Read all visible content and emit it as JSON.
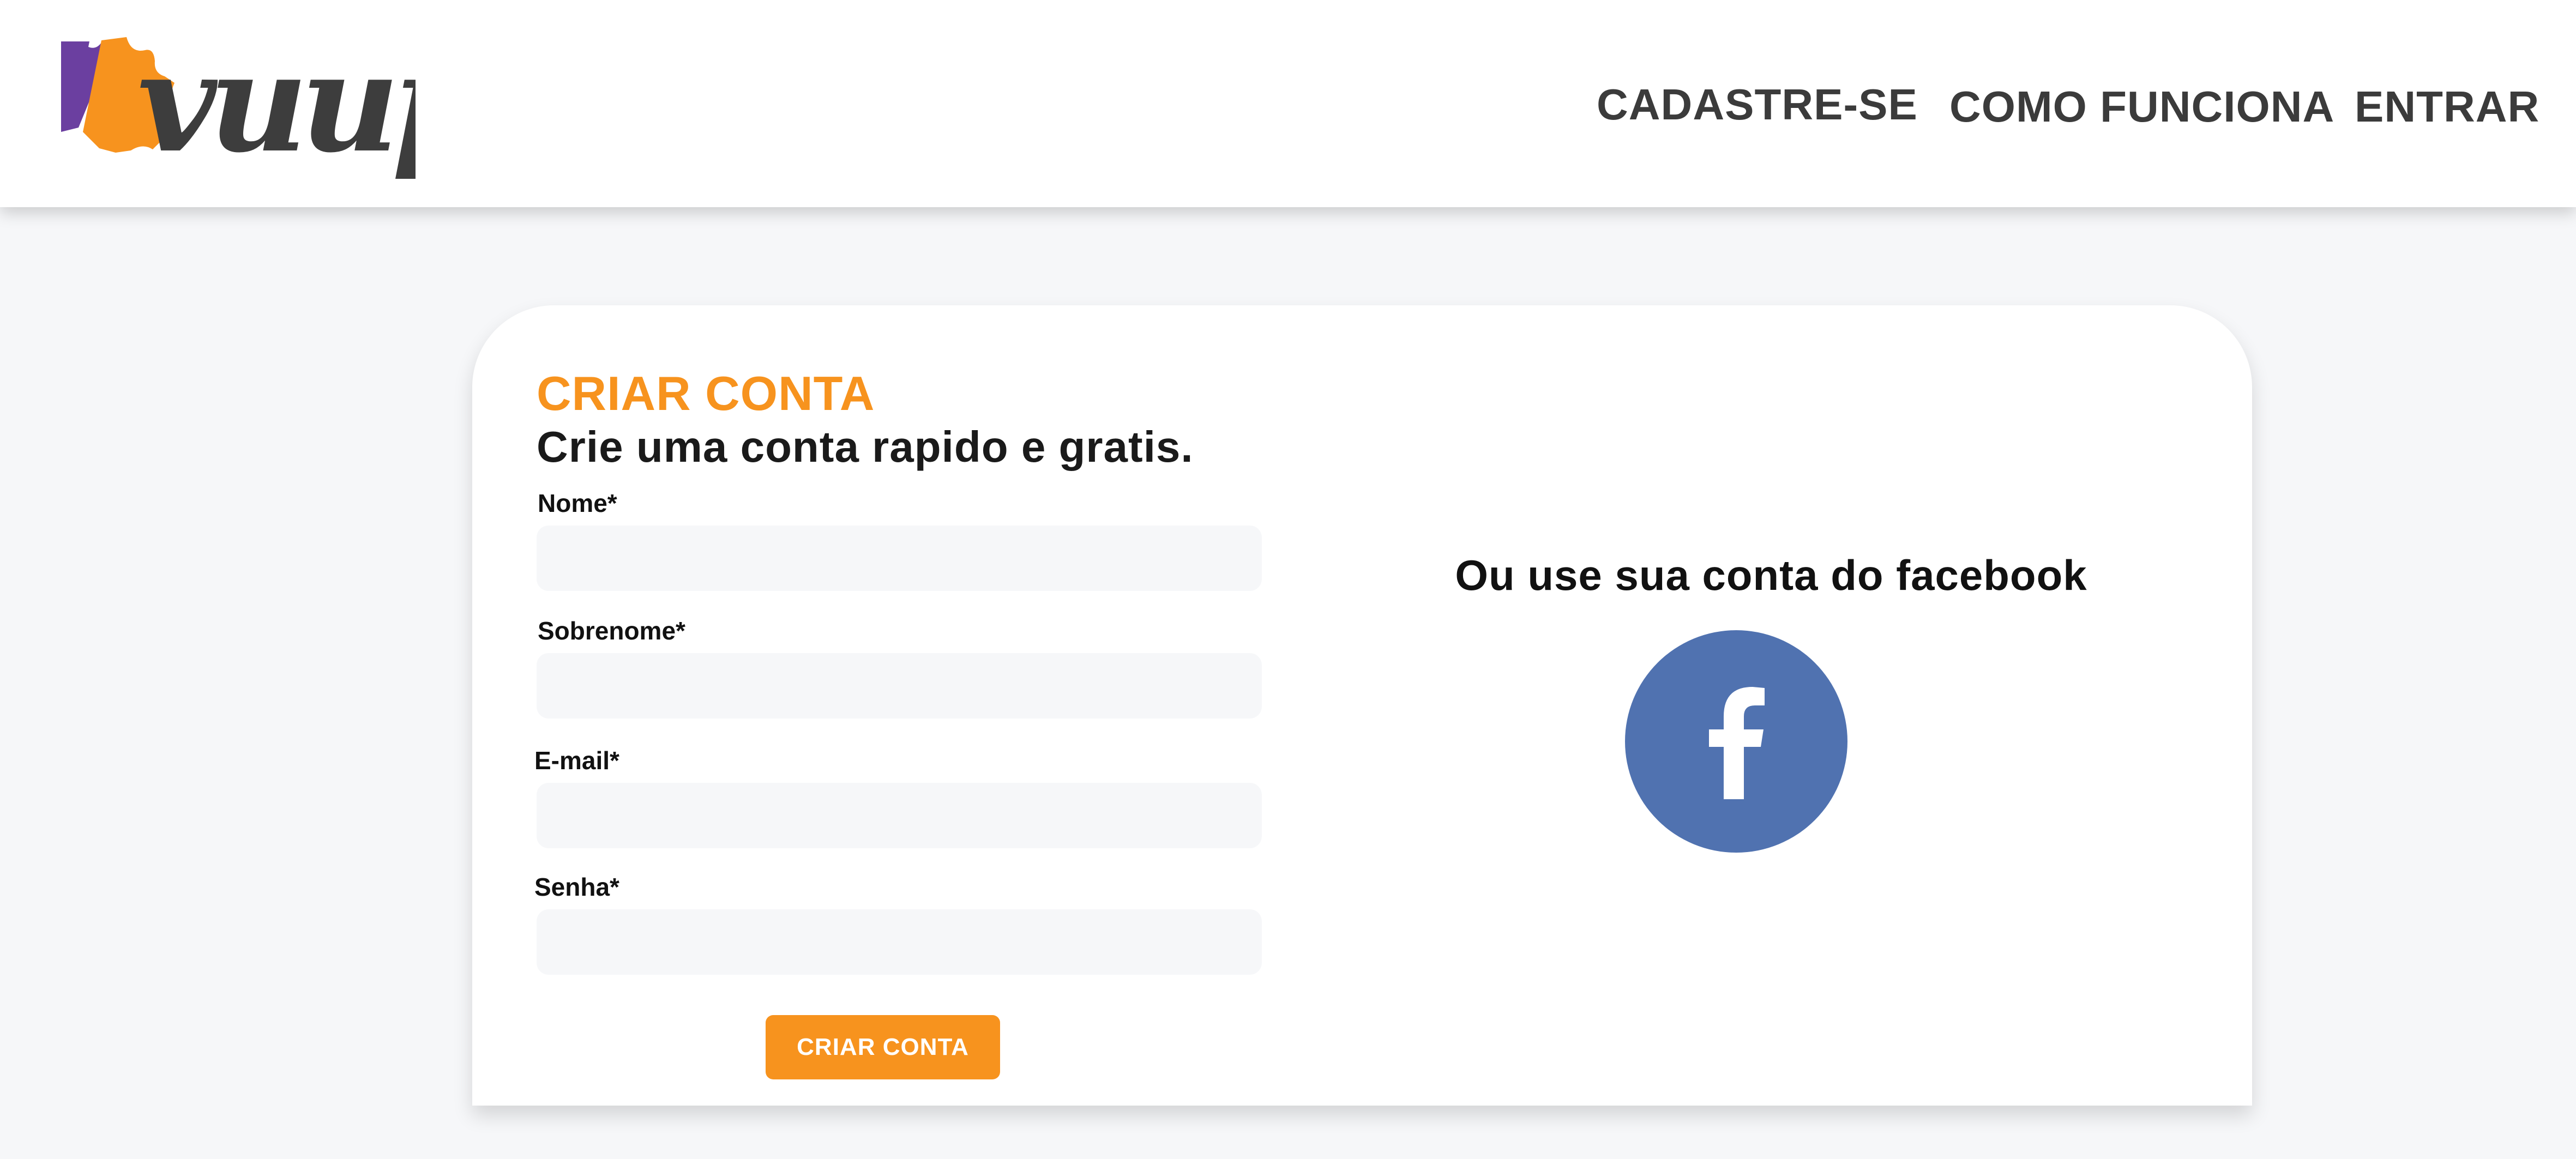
{
  "header": {
    "logo_text": "vuup",
    "nav": {
      "cadastre": "CADASTRE-SE",
      "como_funciona": "COMO FUNCIONA",
      "entrar": "ENTRAR"
    }
  },
  "form": {
    "title": "CRIAR CONTA",
    "subtitle": "Crie uma conta rapido e gratis.",
    "fields": {
      "nome": {
        "label": "Nome*",
        "value": "",
        "placeholder": ""
      },
      "sobrenome": {
        "label": "Sobrenome*",
        "value": "",
        "placeholder": ""
      },
      "email": {
        "label": "E-mail*",
        "value": "",
        "placeholder": ""
      },
      "senha": {
        "label": "Senha*",
        "value": "",
        "placeholder": ""
      }
    },
    "submit_label": "CRIAR CONTA"
  },
  "social": {
    "text": "Ou use sua conta do facebook",
    "icon": "facebook-icon"
  },
  "colors": {
    "accent_orange": "#f7931e",
    "logo_purple": "#6b3fa0",
    "logo_dark": "#3d3d3d",
    "facebook_blue": "#5072b0",
    "page_background": "#f6f7f9"
  }
}
